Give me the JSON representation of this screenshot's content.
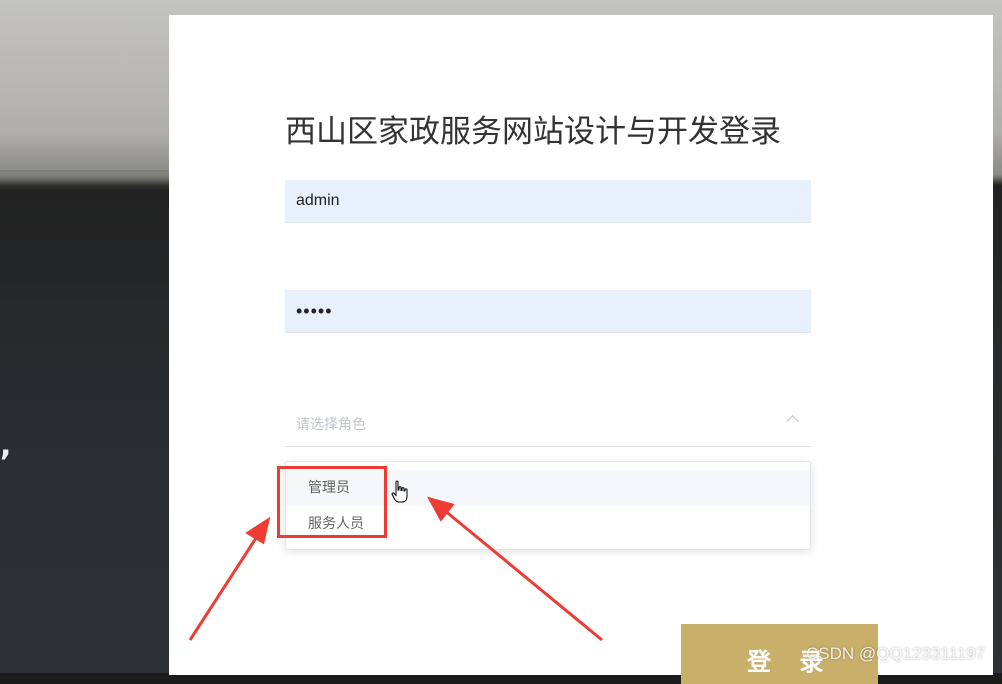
{
  "login": {
    "title": "西山区家政服务网站设计与开发登录",
    "username_value": "admin",
    "password_value": "•••••",
    "role_placeholder": "请选择角色",
    "role_options": [
      "管理员",
      "服务人员"
    ],
    "submit_label": "登 录"
  },
  "background": {
    "comma_text": ","
  },
  "watermark": {
    "text": "CSDN @QQ123311197"
  },
  "icons": {
    "select_toggle": "chevron-up-icon",
    "cursor": "hand-pointer-icon"
  },
  "annotations": {
    "highlight_color": "#ee3b33",
    "arrow_color": "#ee3b33"
  },
  "colors": {
    "input_bg": "#e8f0fe",
    "button_bg": "#c9b06a"
  }
}
